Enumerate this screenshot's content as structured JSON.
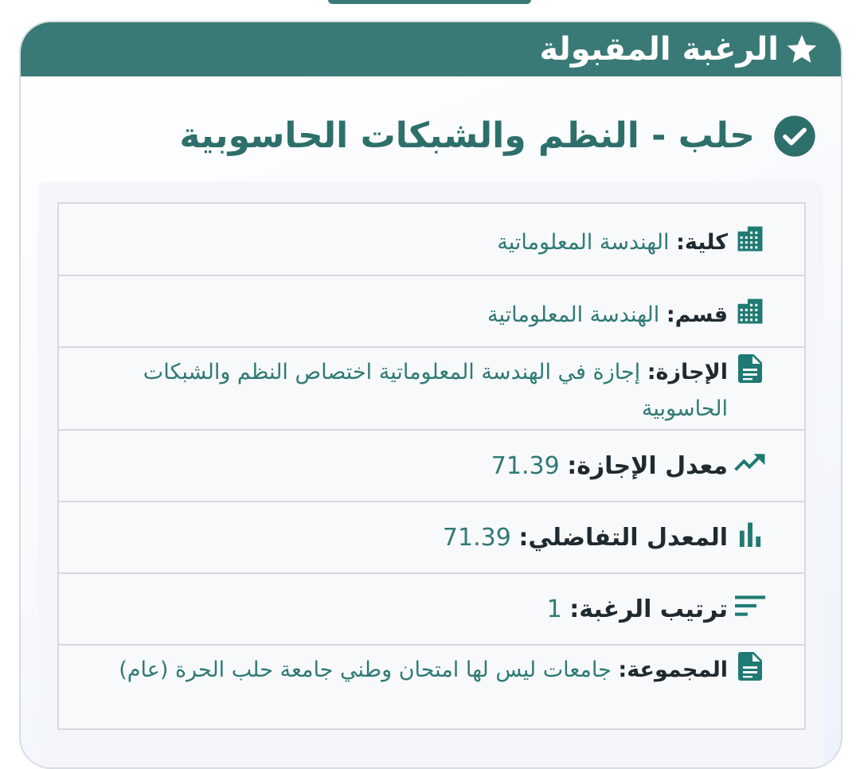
{
  "header": {
    "title": "الرغبة المقبولة",
    "icon": "star-icon"
  },
  "program": {
    "title": "حلب - النظم والشبكات الحاسوبية",
    "icon": "check-circle-icon"
  },
  "details": [
    {
      "icon": "building-icon",
      "label": "كلية:",
      "value": "الهندسة المعلوماتية"
    },
    {
      "icon": "building-icon",
      "label": "قسم:",
      "value": "الهندسة المعلوماتية"
    },
    {
      "icon": "document-icon",
      "label": "الإجازة:",
      "value": "إجازة في الهندسة المعلوماتية اختصاص النظم والشبكات الحاسوبية"
    },
    {
      "icon": "trending-up-icon",
      "label": "معدل الإجازة:",
      "value": "71.39"
    },
    {
      "icon": "bar-chart-icon",
      "label": "المعدل التفاضلي:",
      "value": "71.39"
    },
    {
      "icon": "sort-icon",
      "label": "ترتيب الرغبة:",
      "value": "1"
    },
    {
      "icon": "document-icon",
      "label": "المجموعة:",
      "value": "جامعات ليس لها امتحان وطني جامعة حلب الحرة (عام)"
    }
  ],
  "colors": {
    "accent": "#3a7a76",
    "value_text": "#2f7a75",
    "label_text": "#1f2a30"
  }
}
